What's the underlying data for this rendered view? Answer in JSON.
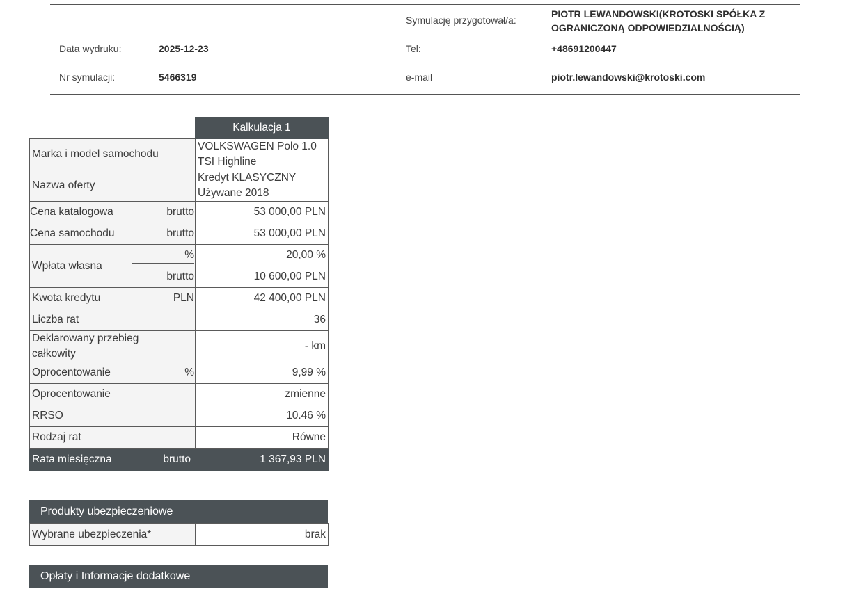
{
  "header": {
    "prepared_by_label": "Symulację przygotował/a:",
    "prepared_by_line1": "PIOTR LEWANDOWSKI(KROTOSKI SPÓŁKA Z",
    "prepared_by_line2": "OGRANICZONĄ ODPOWIEDZIALNOŚCIĄ)",
    "print_date_label": "Data wydruku:",
    "print_date": "2025-12-23",
    "tel_label": "Tel:",
    "tel": "+48691200447",
    "sim_no_label": "Nr symulacji:",
    "sim_no": "5466319",
    "email_label": "e-mail",
    "email": "piotr.lewandowski@krotoski.com"
  },
  "calc": {
    "column_title": "Kalkulacja 1",
    "make_model_label": "Marka i model samochodu",
    "make_model_l1": "VOLKSWAGEN Polo 1.0",
    "make_model_l2": "TSI Highline",
    "offer_label": "Nazwa oferty",
    "offer_l1": "Kredyt KLASYCZNY",
    "offer_l2": "Używane 2018",
    "list_price_label": "Cena katalogowa",
    "list_price_unit": "brutto",
    "list_price": "53 000,00 PLN",
    "car_price_label": "Cena samochodu",
    "car_price_unit": "brutto",
    "car_price": "53 000,00 PLN",
    "down_payment_label": "Wpłata własna",
    "down_payment_pct_unit": "%",
    "down_payment_pct": "20,00 %",
    "down_payment_amt_unit": "brutto",
    "down_payment_amt": "10 600,00 PLN",
    "loan_amount_label": "Kwota kredytu",
    "loan_amount_unit": "PLN",
    "loan_amount": "42 400,00 PLN",
    "installments_label": "Liczba rat",
    "installments": "36",
    "mileage_label_l1": "Deklarowany przebieg",
    "mileage_label_l2": "całkowity",
    "mileage": "- km",
    "interest_label": "Oprocentowanie",
    "interest_unit": "%",
    "interest": "9,99 %",
    "interest_type_label": "Oprocentowanie",
    "interest_type": "zmienne",
    "rrso_label": "RRSO",
    "rrso": "10.46 %",
    "installment_type_label": "Rodzaj rat",
    "installment_type": "Równe",
    "monthly_label": "Rata miesięczna",
    "monthly_unit": "brutto",
    "monthly": "1 367,93 PLN"
  },
  "insurance": {
    "title": "Produkty ubezpieczeniowe",
    "selected_label": "Wybrane ubezpieczenia*",
    "selected_value": "brak"
  },
  "fees": {
    "title": "Opłaty i Informacje dodatkowe"
  }
}
